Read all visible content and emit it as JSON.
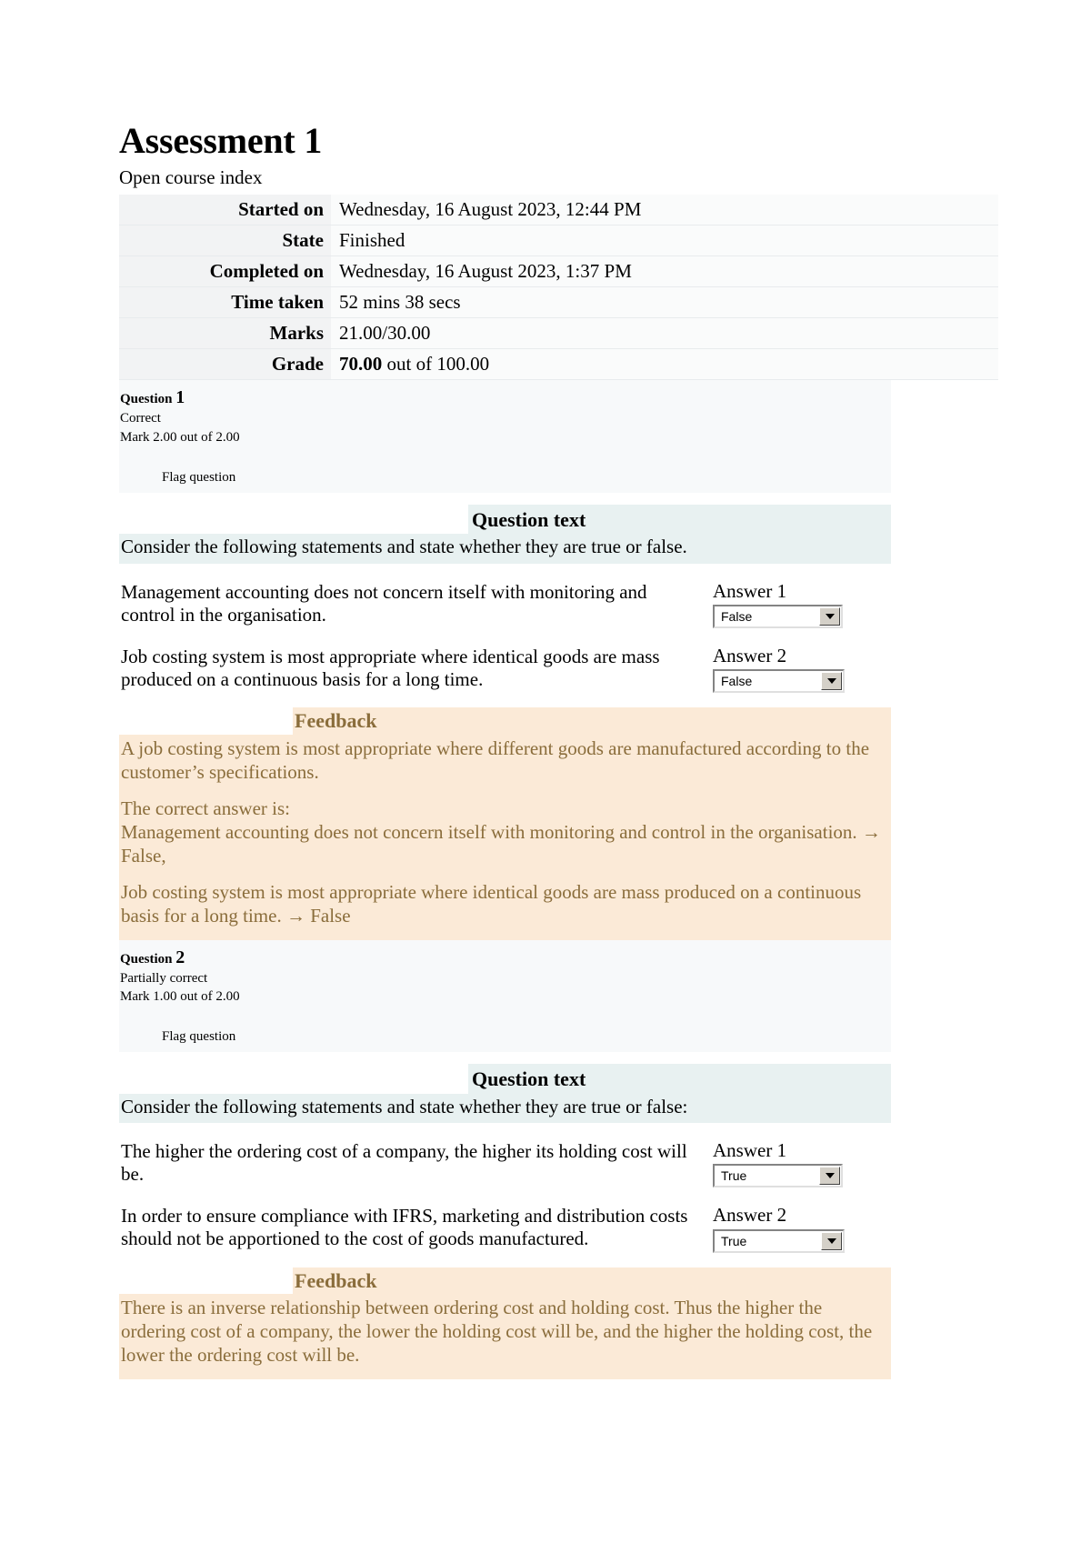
{
  "header": {
    "title": "Assessment 1",
    "course_index_link": "Open course index"
  },
  "summary": {
    "rows": [
      {
        "label": "Started on",
        "value": "Wednesday, 16 August 2023, 12:44 PM"
      },
      {
        "label": "State",
        "value": "Finished"
      },
      {
        "label": "Completed on",
        "value": "Wednesday, 16 August 2023, 1:37 PM"
      },
      {
        "label": "Time taken",
        "value": "52 mins 38 secs"
      },
      {
        "label": "Marks",
        "value": "21.00/30.00"
      }
    ],
    "grade_label": "Grade",
    "grade_value": "70.00",
    "grade_suffix": " out of 100.00"
  },
  "labels": {
    "question_word": "Question",
    "question_text_heading": "Question text",
    "feedback_heading": "Feedback",
    "flag_question": "Flag question"
  },
  "questions": [
    {
      "number": "1",
      "state": "Correct",
      "grade": "Mark 2.00 out of 2.00",
      "question_text": "Consider the following statements and state whether they are true or false.",
      "statements": [
        {
          "text": "Management accounting does not concern itself with monitoring and control in the organisation.",
          "answer_label": "Answer 1",
          "answer_value": "False"
        },
        {
          "text": "Job costing system is most appropriate where identical goods are mass produced on a continuous basis for a long time.",
          "answer_label": "Answer 2",
          "answer_value": "False"
        }
      ],
      "feedback": [
        "A job costing system is most appropriate where different goods are manufactured according to the customer’s specifications.",
        "The correct answer is:",
        "Management accounting does not concern itself with monitoring and control in the organisation. → False,",
        "Job costing system is most appropriate where identical goods are mass produced on a continuous basis for a long time. → False"
      ]
    },
    {
      "number": "2",
      "state": "Partially correct",
      "grade": "Mark 1.00 out of 2.00",
      "question_text": "Consider the following statements and state whether they are true or false:",
      "statements": [
        {
          "text": "The higher the ordering cost of a company, the higher its holding cost will be.",
          "answer_label": "Answer 1",
          "answer_value": "True"
        },
        {
          "text": "In order to ensure compliance with IFRS, marketing and distribution costs should not be apportioned to the cost of goods manufactured.",
          "answer_label": "Answer 2",
          "answer_value": "True"
        }
      ],
      "feedback": [
        "There is an inverse relationship between ordering cost and holding cost. Thus the higher the ordering cost of a company, the lower the holding cost will be, and the higher the holding cost, the lower the ordering cost will be."
      ]
    }
  ],
  "colors": {
    "question_text_bg": "#e8f1f1",
    "feedback_bg": "#fbead7",
    "feedback_text": "#8a6d3b",
    "info_bg": "#f7f9fa",
    "table_label_bg": "#f2f3f4"
  }
}
